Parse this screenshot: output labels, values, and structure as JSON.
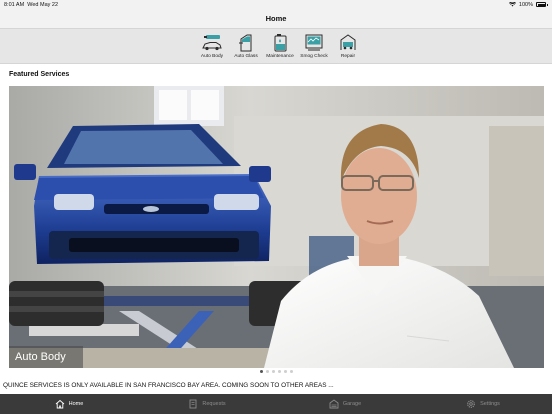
{
  "status_bar": {
    "time": "8:01 AM",
    "date": "Wed May 22",
    "battery_percent": "100%"
  },
  "nav": {
    "title": "Home"
  },
  "services": [
    {
      "label": "Auto Body",
      "icon": "auto-body-icon"
    },
    {
      "label": "Auto Glass",
      "icon": "auto-glass-icon"
    },
    {
      "label": "Maintenance",
      "icon": "maintenance-icon"
    },
    {
      "label": "Smog Check",
      "icon": "smog-check-icon"
    },
    {
      "label": "Repair",
      "icon": "repair-icon"
    }
  ],
  "featured": {
    "title": "Featured Services",
    "slide_caption": "Auto Body",
    "slide_count": 6,
    "active_slide": 1
  },
  "notice": "QUINCE SERVICES IS ONLY AVAILABLE IN SAN FRANCISCO BAY AREA. COMING SOON TO OTHER AREAS ...",
  "tabs": [
    {
      "label": "Home",
      "icon": "home-icon",
      "active": true
    },
    {
      "label": "Requests",
      "icon": "requests-icon",
      "active": false
    },
    {
      "label": "Garage",
      "icon": "garage-icon",
      "active": false
    },
    {
      "label": "Settings",
      "icon": "settings-icon",
      "active": false
    }
  ],
  "colors": {
    "service_icon_accent": "#3aa0a6",
    "tab_bar": "#3a3a3a",
    "active_tab": "#ffffff"
  }
}
